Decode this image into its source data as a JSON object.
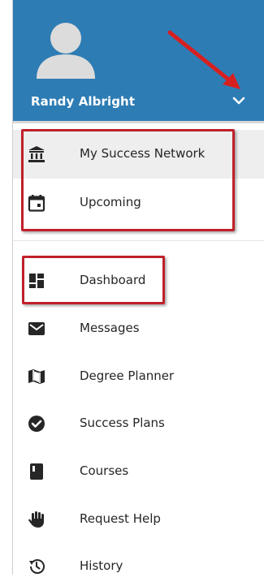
{
  "user": {
    "name": "Randy Albright"
  },
  "icons": {
    "menu_toggle": "chevron-down-icon",
    "avatar": "user-avatar-icon"
  },
  "colors": {
    "header": "#2e7cb4",
    "highlight": "#c0202a",
    "arrow": "#d62020"
  },
  "pinned_items": [
    {
      "label": "My Success Network",
      "icon": "institution-icon"
    },
    {
      "label": "Upcoming",
      "icon": "calendar-icon"
    }
  ],
  "nav_items": [
    {
      "label": "Dashboard",
      "icon": "dashboard-icon"
    },
    {
      "label": "Messages",
      "icon": "envelope-icon"
    },
    {
      "label": "Degree Planner",
      "icon": "map-icon"
    },
    {
      "label": "Success Plans",
      "icon": "check-circle-icon"
    },
    {
      "label": "Courses",
      "icon": "book-icon"
    },
    {
      "label": "Request Help",
      "icon": "hand-icon"
    },
    {
      "label": "History",
      "icon": "history-icon"
    }
  ]
}
